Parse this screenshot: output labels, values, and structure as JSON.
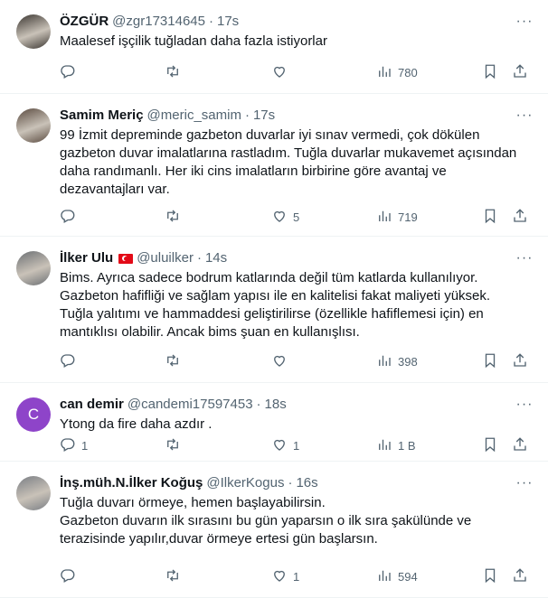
{
  "tweets": [
    {
      "name": "ÖZGÜR",
      "handle": "@zgr17314645",
      "time": "17s",
      "avatar_color": "#3a3530",
      "lines": [
        "Maalesef işçilik tuğladan daha fazla istiyorlar"
      ],
      "replies": "",
      "retweets": "",
      "likes": "",
      "views": "780"
    },
    {
      "name": "Samim Meriç",
      "handle": "@meric_samim",
      "time": "17s",
      "avatar_color": "#5a4a3f",
      "lines": [
        "99 İzmit depreminde gazbeton duvarlar iyi sınav vermedi, çok dökülen",
        "gazbeton duvar imalatlarına rastladım. Tuğla duvarlar mukavemet açısından",
        "daha randımanlı. Her iki cins imalatların birbirine göre avantaj ve",
        "dezavantajları var."
      ],
      "replies": "",
      "retweets": "",
      "likes": "5",
      "views": "719"
    },
    {
      "name": "İlker Ulu",
      "handle": "@uluilker",
      "time": "14s",
      "avatar_color": "#6b6f73",
      "flag": true,
      "lines": [
        "Bims. Ayrıca sadece bodrum katlarında değil tüm katlarda kullanılıyor.",
        "Gazbeton hafifliği ve sağlam yapısı ile en kalitelisi fakat maliyeti yüksek.",
        "Tuğla yalıtımı ve hammaddesi geliştirilirse (özellikle hafiflemesi için) en",
        "mantıklısı olabilir. Ancak bims şuan en kullanışlısı."
      ],
      "replies": "",
      "retweets": "",
      "likes": "",
      "views": "398"
    },
    {
      "name": "can demir",
      "handle": "@candemi17597453",
      "time": "18s",
      "avatar_color": "#8e44c9",
      "avatar_letter": "C",
      "lines": [
        "Ytong da fire daha azdır ."
      ],
      "replies": "1",
      "retweets": "",
      "likes": "1",
      "views": "1 B"
    },
    {
      "name": "İnş.müh.N.İlker Koğuş",
      "handle": "@IlkerKogus",
      "time": "16s",
      "avatar_color": "#7a7e84",
      "lines": [
        "Tuğla duvarı örmeye, hemen başlayabilirsin.",
        "Gazbeton duvarın ilk sırasını bu gün yaparsın o ilk sıra şakülünde ve",
        "terazisinde yapılır,duvar örmeye ertesi gün başlarsın."
      ],
      "replies": "",
      "retweets": "",
      "likes": "1",
      "views": "594"
    }
  ],
  "icons": {
    "reply": "reply-icon",
    "retweet": "retweet-icon",
    "like": "like-icon",
    "views": "views-icon",
    "bookmark": "bookmark-icon",
    "share": "share-icon",
    "more": "more-icon"
  },
  "colors": {
    "text": "#0f1419",
    "secondary": "#536471",
    "divider": "#eff3f4"
  }
}
